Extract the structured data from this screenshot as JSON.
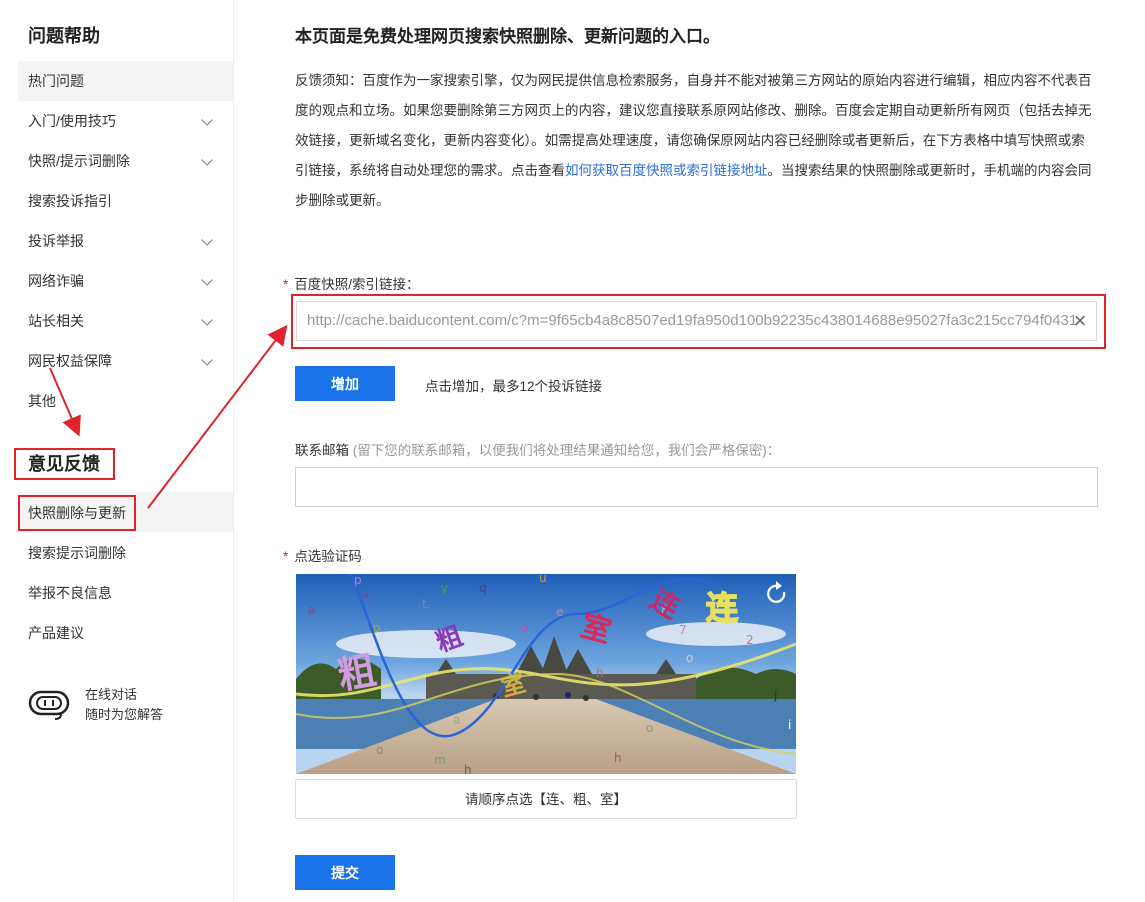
{
  "sidebar": {
    "title": "问题帮助",
    "items": [
      {
        "label": "热门问题",
        "chevron": false
      },
      {
        "label": "入门/使用技巧",
        "chevron": true
      },
      {
        "label": "快照/提示词删除",
        "chevron": true
      },
      {
        "label": "搜索投诉指引",
        "chevron": false
      },
      {
        "label": "投诉举报",
        "chevron": true
      },
      {
        "label": "网络诈骗",
        "chevron": true
      },
      {
        "label": "站长相关",
        "chevron": true
      },
      {
        "label": "网民权益保障",
        "chevron": true
      },
      {
        "label": "其他",
        "chevron": false
      }
    ],
    "feedback_title": "意见反馈",
    "feedback_items": [
      {
        "label": "快照删除与更新"
      },
      {
        "label": "搜索提示词删除"
      },
      {
        "label": "举报不良信息"
      },
      {
        "label": "产品建议"
      }
    ],
    "chat": {
      "line1": "在线对话",
      "line2": "随时为您解答",
      "icon": "headset-icon"
    }
  },
  "main": {
    "title": "本页面是免费处理网页搜索快照删除、更新问题的入口。",
    "notice_before_link": "反馈须知：百度作为一家搜索引擎，仅为网民提供信息检索服务，自身并不能对被第三方网站的原始内容进行编辑，相应内容不代表百度的观点和立场。如果您要删除第三方网页上的内容，建议您直接联系原网站修改、删除。百度会定期自动更新所有网页（包括去掉无效链接，更新域名变化，更新内容变化）。如需提高处理速度，请您确保原网站内容已经删除或者更新后，在下方表格中填写快照或索引链接，系统将自动处理您的需求。点击查看",
    "notice_link": "如何获取百度快照或索引链接地址",
    "notice_after_link": "。当搜索结果的快照删除或更新时，手机端的内容会同步删除或更新。",
    "url_label": "百度快照/索引链接：",
    "url_value": "http://cache.baiducontent.com/c?m=9f65cb4a8c8507ed19fa950d100b92235c438014688e95027fa3c215cc794f0431",
    "add_button": "增加",
    "add_hint": "点击增加，最多12个投诉链接",
    "email_label": "联系邮箱",
    "email_hint": "(留下您的联系邮箱，以便我们将处理结果通知给您，我们会严格保密)：",
    "email_value": "",
    "captcha_label": "点选验证码",
    "captcha_prompt": "请顺序点选【连、粗、室】",
    "submit_button": "提交"
  },
  "colors": {
    "accent": "#1a73e8",
    "annotation_red": "#e0242d",
    "link": "#2b6de0"
  }
}
